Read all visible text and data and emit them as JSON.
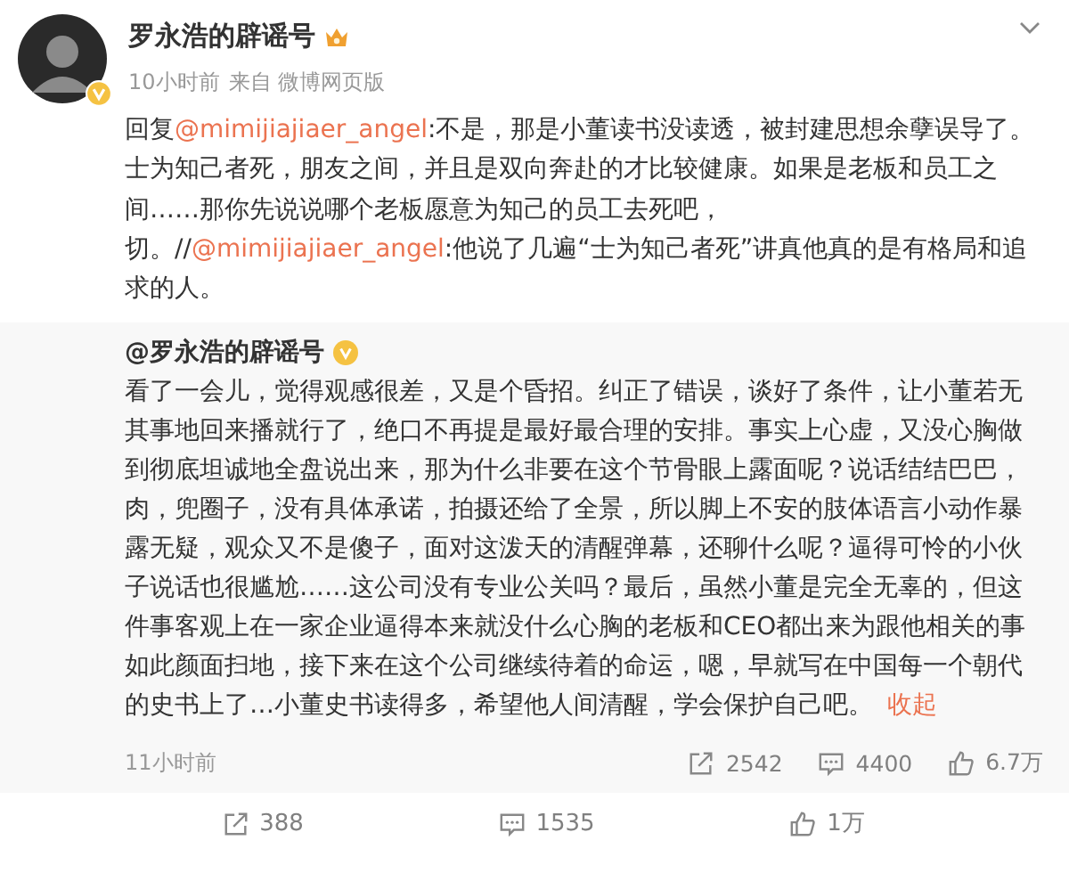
{
  "post": {
    "author": "罗永浩的辟谣号",
    "time": "10小时前",
    "source": "来自 微博网页版",
    "body": [
      {
        "kind": "text",
        "text": "回复"
      },
      {
        "kind": "mention",
        "text": "@mimijiajiaer_angel"
      },
      {
        "kind": "text",
        "text": ":不是，那是小董读书没读透，被封建思想余孽误导了。士为知己者死，朋友之间，并且是双向奔赴的才比较健康。如果是老板和员工之间……那你先说说哪个老板愿意为知己的员工去死吧，切。//"
      },
      {
        "kind": "mention",
        "text": "@mimijiajiaer_angel"
      },
      {
        "kind": "text",
        "text": ":他说了几遍“士为知己者死”讲真他真的是有格局和追求的人。"
      }
    ]
  },
  "repost": {
    "author": "@罗永浩的辟谣号",
    "body": [
      {
        "kind": "text",
        "text": "看了一会儿，觉得观感很差，又是个昏招。纠正了错误，谈好了条件，让小董若无其事地回来播就行了，绝口不再提是最好最合理的安排。事实上心虚，又没心胸做到彻底坦诚地全盘说出来，那为什么非要在这个节骨眼上露面呢？说话结结巴巴，肉，兜圈子，没有具体承诺，拍摄还给了全景，所以脚上不安的肢体语言小动作暴露无疑，观众又不是傻子，面对这泼天的清醒弹幕，还聊什么呢？逼得可怜的小伙子说话也很尴尬……这公司没有专业公关吗？最后，虽然小董是完全无辜的，但这件事客观上在一家企业逼得本来就没什么心胸的老板和CEO都出来为跟他相关的事如此颜面扫地，接下来在这个公司继续待着的命运，嗯，早就写在中国每一个朝代的史书上了…小董史书读得多，希望他人间清醒，学会保护自己吧。"
      },
      {
        "kind": "collapse",
        "text": "收起"
      }
    ],
    "time": "11小时前",
    "stats": [
      {
        "kind": "share",
        "count": "2542"
      },
      {
        "kind": "comment",
        "count": "4400"
      },
      {
        "kind": "like",
        "count": "6.7万"
      }
    ]
  },
  "actions": [
    {
      "kind": "share",
      "count": "388"
    },
    {
      "kind": "comment",
      "count": "1535"
    },
    {
      "kind": "like",
      "count": "1万"
    }
  ]
}
